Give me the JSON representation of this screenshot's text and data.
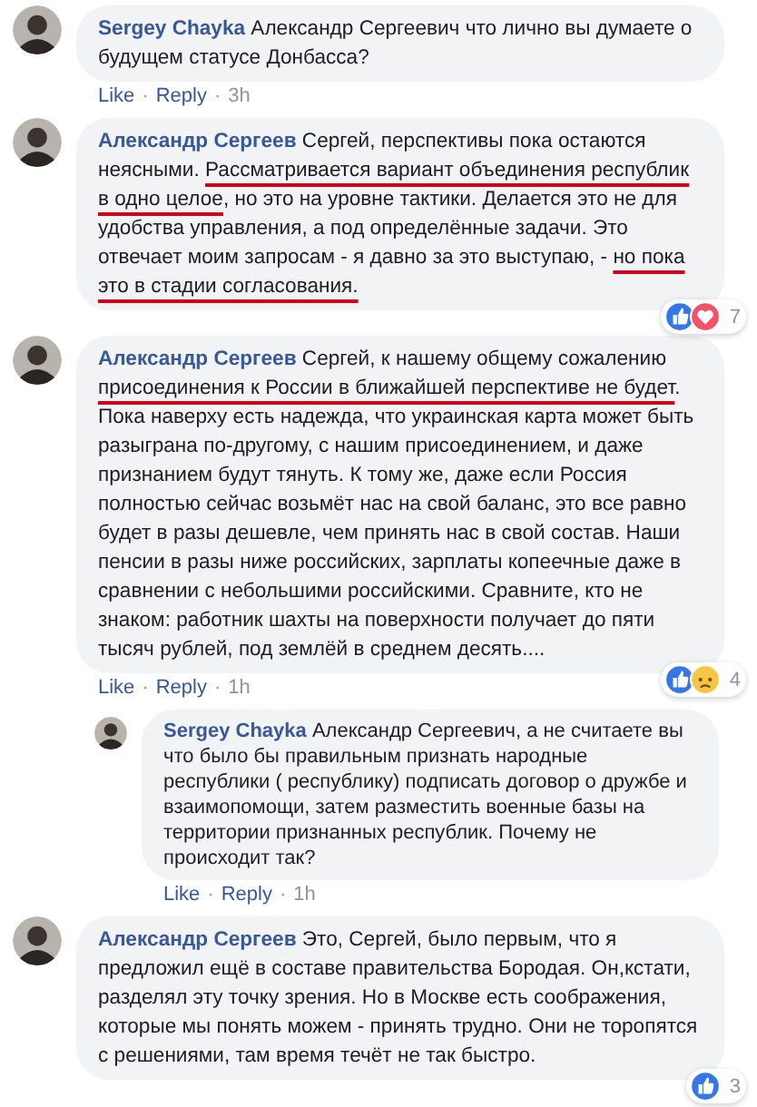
{
  "comments": [
    {
      "author": "Sergey Chayka",
      "segments": [
        {
          "text": "Александр Сергеевич что лично вы думаете о будущем статусе Донбасса?"
        }
      ],
      "actions": [
        {
          "text": "Like",
          "kind": "link"
        },
        {
          "text": "·",
          "kind": "separator"
        },
        {
          "text": "Reply",
          "kind": "link"
        },
        {
          "text": "·",
          "kind": "separator"
        },
        {
          "text": "3h",
          "kind": "time"
        }
      ]
    },
    {
      "author": "Александр Сергеев",
      "segments": [
        {
          "text": "Сергей, перспективы пока остаются неясными. "
        },
        {
          "text": "Рассматривается вариант объединения республик в одно целое",
          "underlined": true
        },
        {
          "text": ", но это на уровне тактики. Делается это не для удобства управления, а под определённые задачи. Это отвечает моим запросам - я давно за это выступаю, - "
        },
        {
          "text": "но пока это в стадии согласования.",
          "underlined": true
        }
      ],
      "reactions": [
        {
          "kind": "like"
        },
        {
          "kind": "love"
        }
      ],
      "reaction_count": "7"
    },
    {
      "author": "Александр Сергеев",
      "segments": [
        {
          "text": "Сергей, к нашему общему сожалению "
        },
        {
          "text": "присоединения к России в ближайшей перспективе не будет",
          "underlined": true
        },
        {
          "text": ". Пока наверху есть надежда, что украинская карта может быть разыграна по-другому, с нашим присоединением, и даже признанием будут тянуть. К тому же, даже если Россия полностью сейчас возьмёт нас на свой баланс, это все равно будет в разы дешевле, чем принять нас в свой состав. Наши пенсии в разы ниже российских, зарплаты копеечные даже в сравнении с небольшими российскими. Сравните, кто не знаком: работник шахты на поверхности получает до пяти тысяч рублей, под землёй в среднем десять...."
        }
      ],
      "reactions": [
        {
          "kind": "like"
        },
        {
          "kind": "sad"
        }
      ],
      "reaction_count": "4",
      "actions": [
        {
          "text": "Like",
          "kind": "link"
        },
        {
          "text": "·",
          "kind": "separator"
        },
        {
          "text": "Reply",
          "kind": "link"
        },
        {
          "text": "·",
          "kind": "separator"
        },
        {
          "text": "1h",
          "kind": "time"
        }
      ],
      "children": [
        {
          "author": "Sergey Chayka",
          "segments": [
            {
              "text": "Александр Сергеевич, а не считаете вы что было бы правильным признать народные республики ( республику) подписать договор о дружбе и взаимопомощи, затем разместить военные базы на территории признанных республик. Почему не происходит так?"
            }
          ],
          "actions": [
            {
              "text": "Like",
              "kind": "link"
            },
            {
              "text": "·",
              "kind": "separator"
            },
            {
              "text": "Reply",
              "kind": "link"
            },
            {
              "text": "·",
              "kind": "separator"
            },
            {
              "text": "1h",
              "kind": "time"
            }
          ]
        }
      ]
    },
    {
      "author": "Александр Сергеев",
      "segments": [
        {
          "text": "Это, Сергей, было первым, что я предложил ещё в составе правительства Бородая. Он,кстати, разделял эту точку зрения. Но в Москве есть соображения, которые мы понять можем - принять трудно. Они не торопятся с решениями, там время течёт не так быстро."
        }
      ],
      "reactions": [
        {
          "kind": "like"
        }
      ],
      "reaction_count": "3"
    }
  ]
}
